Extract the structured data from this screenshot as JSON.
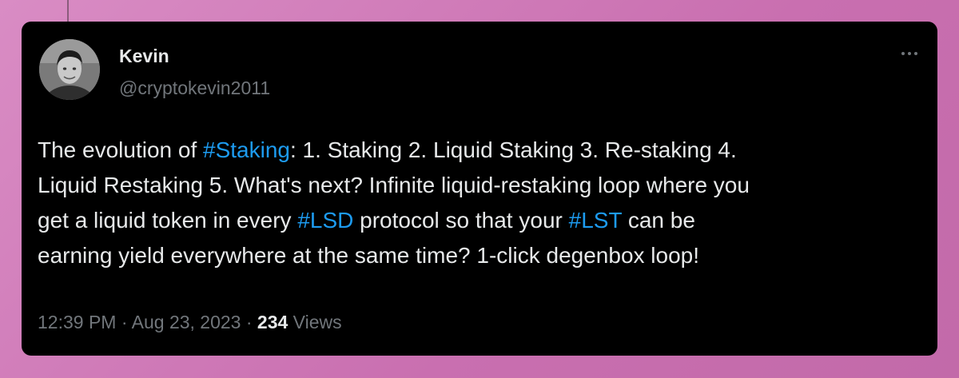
{
  "author": {
    "name": "Kevin",
    "handle": "@cryptokevin2011",
    "avatar_icon": "profile-photo"
  },
  "more_icon": "ellipsis-icon",
  "tweet": {
    "lines": [
      [
        {
          "text": "The evolution of ",
          "type": "text"
        },
        {
          "text": "#Staking",
          "type": "hashtag"
        },
        {
          "text": ": 1. Staking 2. Liquid Staking 3. Re-staking 4.",
          "type": "text"
        }
      ],
      [
        {
          "text": "Liquid Restaking 5. What's next? Infinite liquid-restaking loop where you",
          "type": "text"
        }
      ],
      [
        {
          "text": "get a liquid token in every ",
          "type": "text"
        },
        {
          "text": "#LSD",
          "type": "hashtag"
        },
        {
          "text": " protocol so that your ",
          "type": "text"
        },
        {
          "text": "#LST",
          "type": "hashtag"
        },
        {
          "text": " can be",
          "type": "text"
        }
      ],
      [
        {
          "text": "earning yield everywhere at the same time? 1-click degenbox loop!",
          "type": "text"
        }
      ]
    ]
  },
  "meta": {
    "time": "12:39 PM",
    "separator": " · ",
    "date": "Aug 23, 2023",
    "views_count": "234",
    "views_label": " Views"
  },
  "colors": {
    "background": "#c96fb0",
    "card": "#000000",
    "text": "#e7e9ea",
    "muted": "#71767b",
    "link": "#1d9bf0"
  }
}
